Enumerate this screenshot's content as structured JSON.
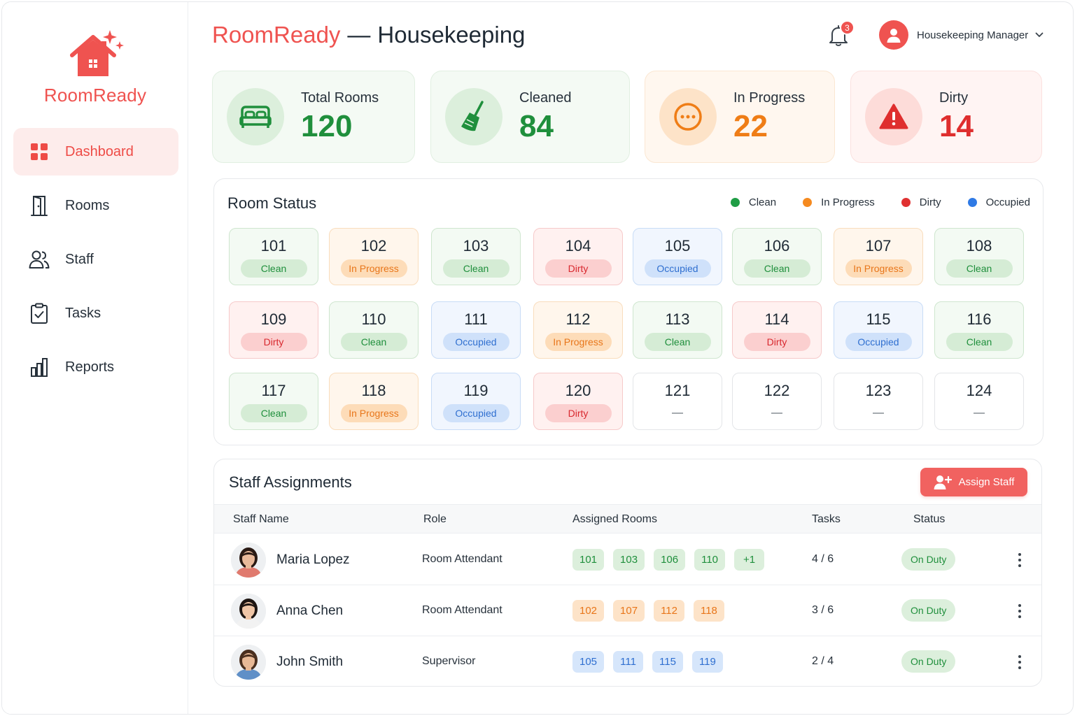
{
  "sidebar": {
    "logo_text": "RoomReady",
    "items": [
      {
        "label": "Dashboard",
        "icon": "grid-icon",
        "active": true
      },
      {
        "label": "Rooms",
        "icon": "door-icon"
      },
      {
        "label": "Staff",
        "icon": "users-icon"
      },
      {
        "label": "Tasks",
        "icon": "clipboard-check-icon"
      },
      {
        "label": "Reports",
        "icon": "bar-chart-icon"
      }
    ]
  },
  "header": {
    "brand": "RoomReady",
    "separator": "—",
    "section": "Housekeeping",
    "notification_count": "3",
    "user_role": "Housekeeping Manager"
  },
  "stats": [
    {
      "label": "Total Rooms",
      "value": "120",
      "icon": "bed-icon",
      "tone": "green"
    },
    {
      "label": "Cleaned",
      "value": "84",
      "icon": "broom-icon",
      "tone": "green"
    },
    {
      "label": "In Progress",
      "value": "22",
      "icon": "ellipsis-circle-icon",
      "tone": "orange"
    },
    {
      "label": "Dirty",
      "value": "14",
      "icon": "warning-icon",
      "tone": "red"
    }
  ],
  "room_status": {
    "title": "Room Status",
    "legend": [
      {
        "label": "Clean",
        "color": "#1f9d45"
      },
      {
        "label": "In Progress",
        "color": "#f58a1f"
      },
      {
        "label": "Dirty",
        "color": "#e03131"
      },
      {
        "label": "Occupied",
        "color": "#2f7ae5"
      }
    ],
    "rooms": [
      {
        "number": "101",
        "status": "Clean"
      },
      {
        "number": "102",
        "status": "In Progress"
      },
      {
        "number": "103",
        "status": "Clean"
      },
      {
        "number": "104",
        "status": "Dirty"
      },
      {
        "number": "105",
        "status": "Occupied"
      },
      {
        "number": "106",
        "status": "Clean"
      },
      {
        "number": "107",
        "status": "In Progress"
      },
      {
        "number": "108",
        "status": "Clean"
      },
      {
        "number": "109",
        "status": "Dirty"
      },
      {
        "number": "110",
        "status": "Clean"
      },
      {
        "number": "111",
        "status": "Occupied"
      },
      {
        "number": "112",
        "status": "In Progress"
      },
      {
        "number": "113",
        "status": "Clean"
      },
      {
        "number": "114",
        "status": "Dirty"
      },
      {
        "number": "115",
        "status": "Occupied"
      },
      {
        "number": "116",
        "status": "Clean"
      },
      {
        "number": "117",
        "status": "Clean"
      },
      {
        "number": "118",
        "status": "In Progress"
      },
      {
        "number": "119",
        "status": "Occupied"
      },
      {
        "number": "120",
        "status": "Dirty"
      },
      {
        "number": "121",
        "status": "—"
      },
      {
        "number": "122",
        "status": "—"
      },
      {
        "number": "123",
        "status": "—"
      },
      {
        "number": "124",
        "status": "—"
      }
    ]
  },
  "staff": {
    "title": "Staff Assignments",
    "assign_label": "Assign Staff",
    "columns": [
      "Staff Name",
      "Role",
      "Assigned Rooms",
      "Tasks",
      "Status"
    ],
    "rows": [
      {
        "name": "Maria Lopez",
        "role": "Room Attendant",
        "rooms": [
          "101",
          "103",
          "106",
          "110",
          "+1"
        ],
        "tone": "g",
        "tasks": "4 / 6",
        "status": "On Duty"
      },
      {
        "name": "Anna Chen",
        "role": "Room Attendant",
        "rooms": [
          "102",
          "107",
          "112",
          "118"
        ],
        "tone": "o",
        "tasks": "3 / 6",
        "status": "On Duty"
      },
      {
        "name": "John Smith",
        "role": "Supervisor",
        "rooms": [
          "105",
          "111",
          "115",
          "119"
        ],
        "tone": "b",
        "tasks": "2 / 4",
        "status": "On Duty"
      }
    ]
  }
}
